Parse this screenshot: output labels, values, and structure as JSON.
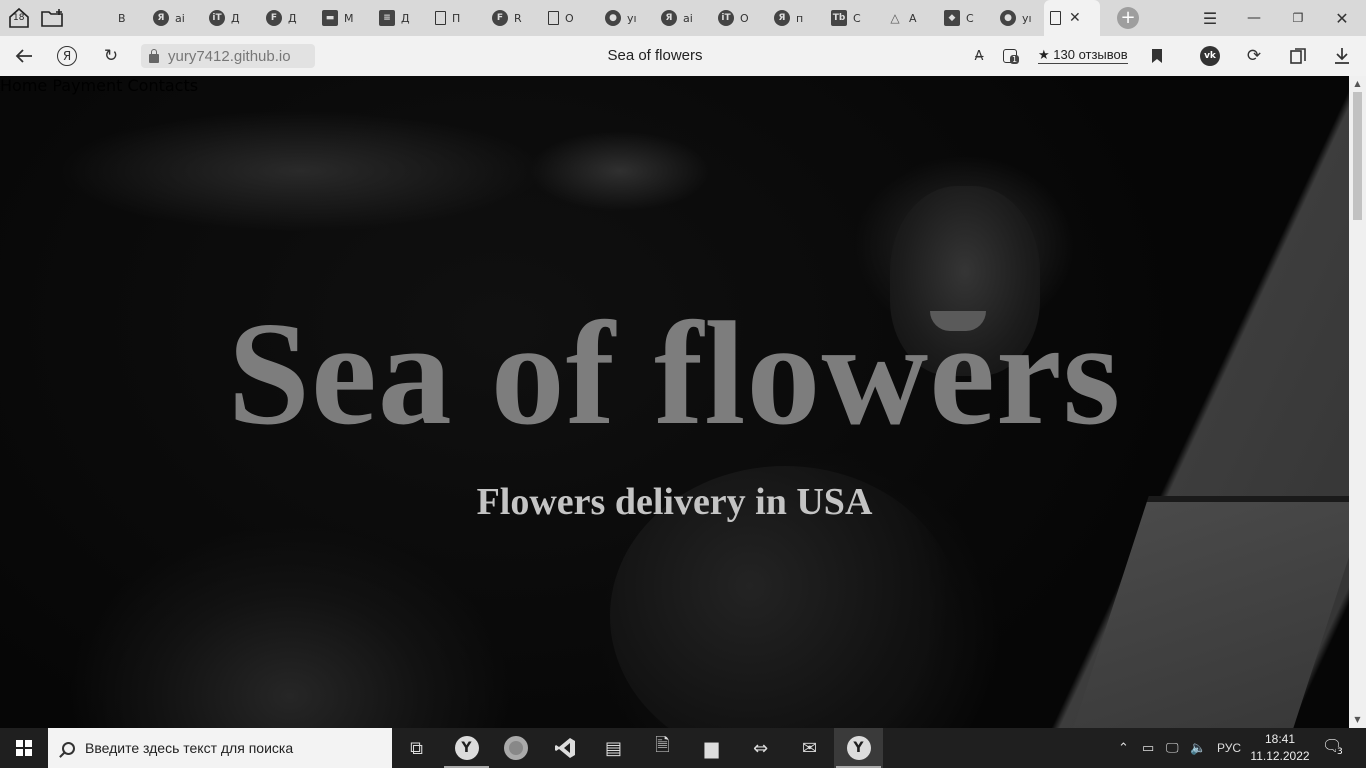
{
  "browser": {
    "tab_counter": "18",
    "tabs": [
      {
        "letter": "",
        "label": "В",
        "icon": "search-icon"
      },
      {
        "letter": "Я",
        "label": "ai",
        "icon": "yandex-icon"
      },
      {
        "letter": "iT",
        "label": "Д",
        "icon": "it-icon"
      },
      {
        "letter": "F",
        "label": "Д",
        "icon": "figma-icon"
      },
      {
        "letter": "▬",
        "label": "М",
        "icon": "chat-icon"
      },
      {
        "letter": "≡",
        "label": "Д",
        "icon": "list-icon"
      },
      {
        "letter": "",
        "label": "П",
        "icon": "document-icon"
      },
      {
        "letter": "F",
        "label": "R",
        "icon": "figma-icon"
      },
      {
        "letter": "",
        "label": "О",
        "icon": "document-icon"
      },
      {
        "letter": "●",
        "label": "yı",
        "icon": "github-icon"
      },
      {
        "letter": "Я",
        "label": "ai",
        "icon": "yandex-icon"
      },
      {
        "letter": "iT",
        "label": "О",
        "icon": "it-icon"
      },
      {
        "letter": "Я",
        "label": "п",
        "icon": "yandex-icon"
      },
      {
        "letter": "Tb",
        "label": "С",
        "icon": "tb-icon"
      },
      {
        "letter": "△",
        "label": "А",
        "icon": "drive-icon"
      },
      {
        "letter": "◆",
        "label": "С",
        "icon": "stepik-icon"
      },
      {
        "letter": "●",
        "label": "yı",
        "icon": "github-icon"
      }
    ],
    "active_tab": {
      "icon": "document-icon",
      "close": "✕"
    },
    "new_tab": "+",
    "url": "yury7412.github.io",
    "page_title": "Sea of flowers",
    "reviews": "★ 130 отзывов",
    "extension_badge": "1"
  },
  "page": {
    "nav": [
      "Home",
      "Payment",
      "Contacts"
    ],
    "title": "Sea of flowers",
    "subtitle": "Flowers delivery in USA"
  },
  "taskbar": {
    "search_placeholder": "Введите здесь текст для поиска",
    "language": "РУС",
    "time": "18:41",
    "date": "11.12.2022",
    "notifications": "3"
  }
}
